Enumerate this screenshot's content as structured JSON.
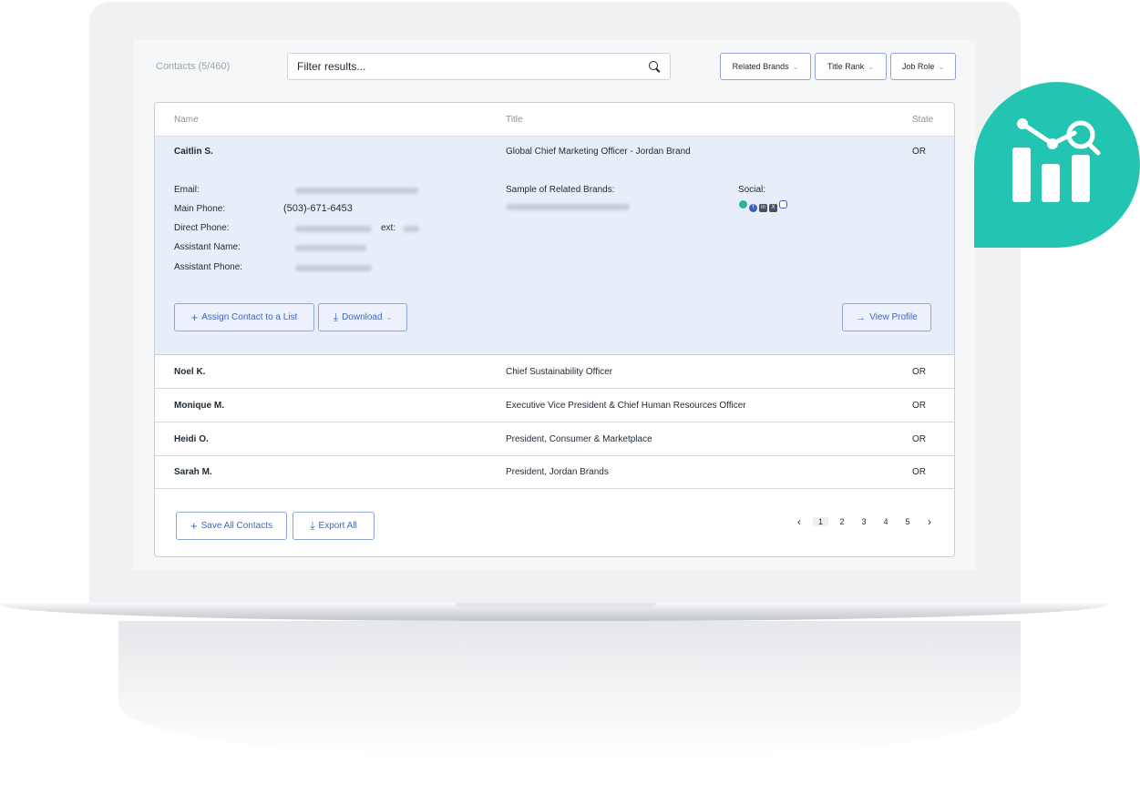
{
  "toolbar": {
    "contacts_count": "Contacts (5/460)",
    "filter_placeholder": "Filter results...",
    "filters": [
      {
        "label": "Related Brands"
      },
      {
        "label": "Title Rank"
      },
      {
        "label": "Job Role"
      }
    ]
  },
  "table": {
    "columns": {
      "name": "Name",
      "title": "Title",
      "state": "State"
    },
    "rows": [
      {
        "name": "Caitlin S.",
        "title": "Global Chief Marketing Officer - Jordan Brand",
        "state": "OR"
      },
      {
        "name": "Noel K.",
        "title": "Chief Sustainability Officer",
        "state": "OR"
      },
      {
        "name": "Monique M.",
        "title": "Executive Vice President & Chief Human Resources Officer",
        "state": "OR"
      },
      {
        "name": "Heidi O.",
        "title": "President, Consumer & Marketplace",
        "state": "OR"
      },
      {
        "name": "Sarah M.",
        "title": "President, Jordan Brands",
        "state": "OR"
      }
    ]
  },
  "detail": {
    "email_label": "Email:",
    "main_phone_label": "Main Phone:",
    "main_phone_value": "(503)-671-6453",
    "direct_phone_label": "Direct Phone:",
    "ext_label": "ext:",
    "assistant_name_label": "Assistant Name:",
    "assistant_phone_label": "Assistant Phone:",
    "related_brands_label": "Sample of Related Brands:",
    "social_label": "Social:",
    "social_icons": [
      "globe-icon",
      "facebook-icon",
      "linkedin-icon",
      "x-icon",
      "instagram-icon"
    ],
    "assign_label": "Assign Contact to a List",
    "download_label": "Download",
    "view_profile_label": "View Profile"
  },
  "footer": {
    "save_all_label": "Save All Contacts",
    "export_all_label": "Export All",
    "pages": [
      "1",
      "2",
      "3",
      "4",
      "5"
    ],
    "current_page": "1"
  },
  "colors": {
    "accent": "#3f67c4",
    "expanded_row": "#e7eef9",
    "badge": "#23c4b1"
  }
}
